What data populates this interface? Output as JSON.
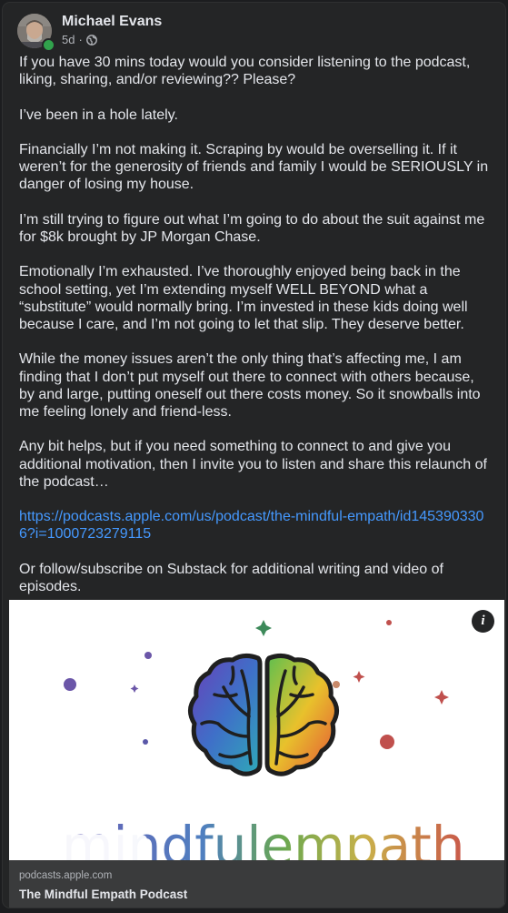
{
  "post": {
    "author": "Michael Evans",
    "timestamp": "5d",
    "separator": "·",
    "audience_icon": "globe-icon",
    "body": {
      "p1": "If you have 30 mins today would you consider listening to the podcast, liking, sharing, and/or reviewing?? Please?",
      "p2": "I’ve been in a hole lately.",
      "p3": "Financially I’m not making it. Scraping by would be overselling it. If it weren’t for the generosity of friends and family I would be SERIOUSLY in danger of losing my house.",
      "p4": "I’m still trying to figure out what I’m going to do about the suit against me for $8k brought by JP Morgan Chase.",
      "p5": "Emotionally I’m exhausted. I’ve thoroughly enjoyed being back in the school setting, yet I’m extending myself WELL BEYOND what a “substitute” would normally bring. I’m invested in these kids doing well because I care, and I’m not going to let that slip. They deserve better.",
      "p6": "While the money issues aren’t the only thing that’s affecting me, I am finding that I don’t put myself out there to connect with others because, by and large, putting oneself out there costs money. So it snowballs into me feeling lonely and friend-less.",
      "p7": "Any bit helps, but if you need something to connect to and give you additional motivation, then I invite you to listen and share this relaunch of the podcast…",
      "link": "https://podcasts.apple.com/us/podcast/the-mindful-empath/id1453903306?i=1000723279115",
      "p8": "Or follow/subscribe on Substack for additional writing and video of episodes."
    },
    "link_preview": {
      "image_text": "mindfulempath",
      "info_label": "i",
      "domain": "podcasts.apple.com",
      "title": "The Mindful Empath Podcast"
    }
  },
  "colors": {
    "card_bg": "#242526",
    "text": "#e4e6eb",
    "secondary_text": "#b0b3b8",
    "link": "#4599ff",
    "online": "#31a24c",
    "caption_bg": "#3a3b3c"
  }
}
